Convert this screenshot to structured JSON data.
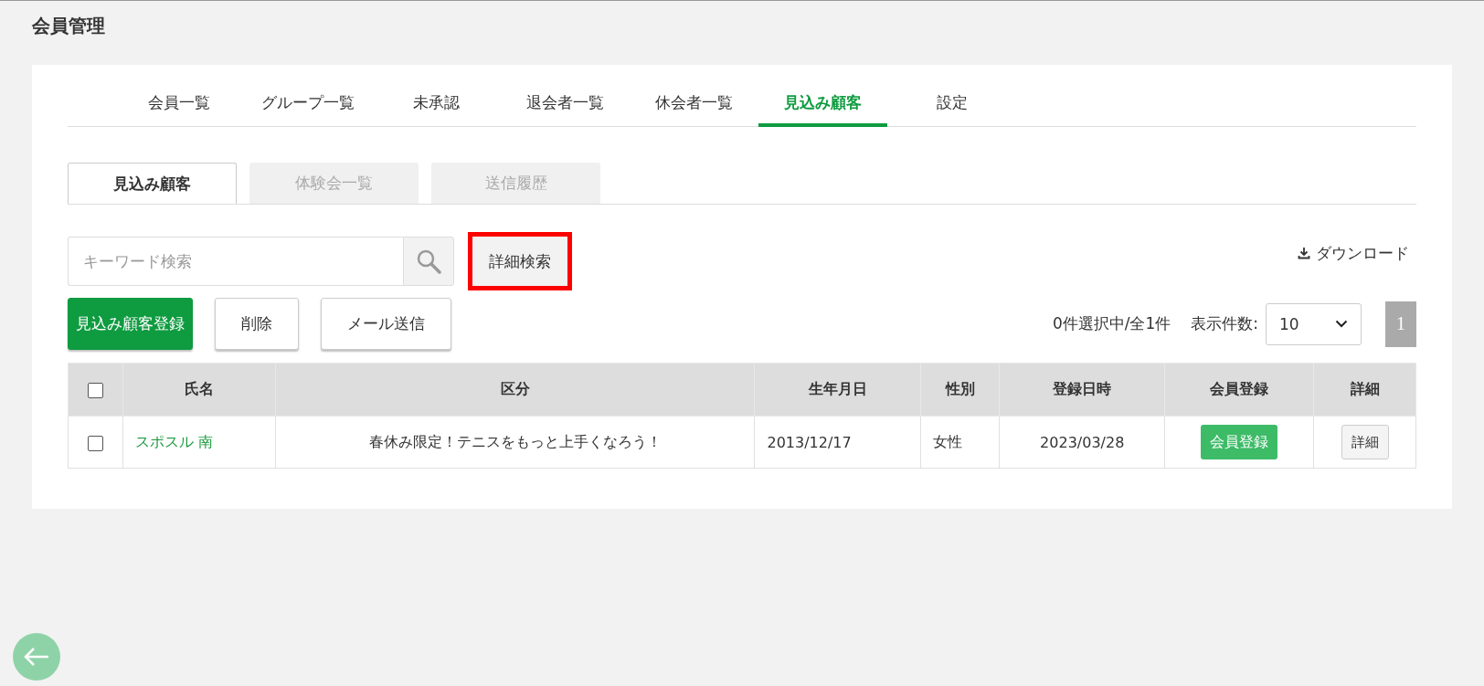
{
  "page_title": "会員管理",
  "tabs": [
    {
      "label": "会員一覧",
      "selected": false
    },
    {
      "label": "グループ一覧",
      "selected": false
    },
    {
      "label": "未承認",
      "selected": false
    },
    {
      "label": "退会者一覧",
      "selected": false
    },
    {
      "label": "休会者一覧",
      "selected": false
    },
    {
      "label": "見込み顧客",
      "selected": true
    },
    {
      "label": "設定",
      "selected": false
    }
  ],
  "subtabs": [
    {
      "label": "見込み顧客",
      "selected": true
    },
    {
      "label": "体験会一覧",
      "selected": false
    },
    {
      "label": "送信履歴",
      "selected": false
    }
  ],
  "search": {
    "placeholder": "キーワード検索"
  },
  "advanced_search": {
    "label": "詳細検索",
    "highlighted": true
  },
  "download": "ダウンロード",
  "actions": [
    {
      "label": "見込み顧客登録",
      "kind": "primary"
    },
    {
      "label": "削除",
      "kind": "secondary"
    },
    {
      "label": "メール送信",
      "kind": "secondary"
    }
  ],
  "selection_count": "0件選択中/全1件",
  "page_size": {
    "label": "表示件数:",
    "value": "10"
  },
  "pages": [
    {
      "label": "1",
      "selected": true
    }
  ],
  "table": {
    "columns": [
      "氏名",
      "区分",
      "生年月日",
      "性別",
      "登録日時",
      "会員登録",
      "詳細"
    ],
    "select_all_checked": false,
    "rows": [
      {
        "checked": false,
        "name": "スポスル 南",
        "category": "春休み限定！テニスをもっと上手くなろう！",
        "birthdate": "2013/12/17",
        "gender": "女性",
        "registered": "2023/03/28",
        "register_button": "会員登録",
        "detail_button": "詳細"
      }
    ]
  }
}
